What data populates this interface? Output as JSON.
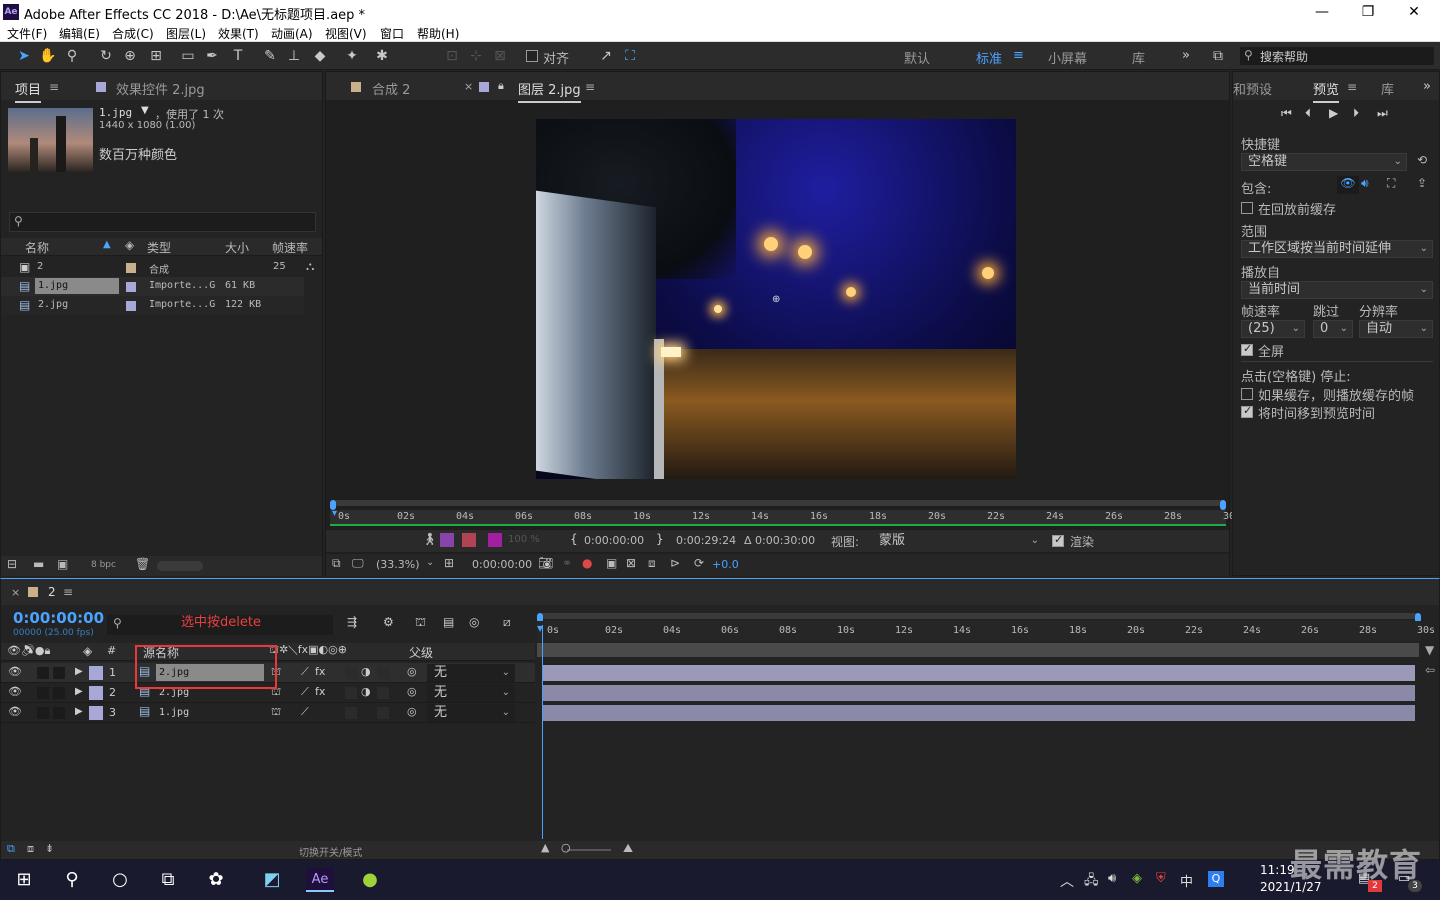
{
  "window": {
    "title": "Adobe After Effects CC 2018 - D:\\Ae\\无标题项目.aep *",
    "logo": "Ae"
  },
  "menu": [
    "文件(F)",
    "编辑(E)",
    "合成(C)",
    "图层(L)",
    "效果(T)",
    "动画(A)",
    "视图(V)",
    "窗口",
    "帮助(H)"
  ],
  "toolbar": {
    "snap_label": "对齐",
    "workspaces": [
      "默认",
      "标准",
      "小屏幕",
      "库"
    ],
    "active_workspace": "标准",
    "search_placeholder": "搜索帮助"
  },
  "project_panel": {
    "tabs": [
      "项目",
      "效果控件 2.jpg"
    ],
    "selected_name": "1.jpg",
    "usage": "，使用了 1 次",
    "dimensions": "1440 x 1080 (1.00)",
    "color_info": "数百万种颜色",
    "columns": [
      "名称",
      "类型",
      "大小",
      "帧速率"
    ],
    "items": [
      {
        "name": "2",
        "type": "合成",
        "size": "",
        "fps": "25",
        "color": "#c8b08a"
      },
      {
        "name": "1.jpg",
        "type": "Importe...G",
        "size": "61 KB",
        "fps": "",
        "color": "#a8a8d8"
      },
      {
        "name": "2.jpg",
        "type": "Importe...G",
        "size": "122 KB",
        "fps": "",
        "color": "#a8a8d8"
      }
    ],
    "bpc": "8 bpc"
  },
  "viewer": {
    "tabs": [
      "合成 2",
      "图层 2.jpg"
    ],
    "ruler_ticks": [
      "0s",
      "02s",
      "04s",
      "06s",
      "08s",
      "10s",
      "12s",
      "14s",
      "16s",
      "18s",
      "20s",
      "22s",
      "24s",
      "26s",
      "28s",
      "30s"
    ],
    "pct": "100 %",
    "in_time": "0:00:00:00",
    "out_time": "0:00:29:24",
    "duration": "Δ 0:00:30:00",
    "view_label": "视图:",
    "view_value": "蒙版",
    "render_label": "渲染",
    "zoom": "(33.3%)",
    "current_time": "0:00:00:00",
    "exposure": "+0.0"
  },
  "preview_panel": {
    "tabs": [
      "和预设",
      "预览",
      "库"
    ],
    "shortcut_label": "快捷键",
    "shortcut_value": "空格键",
    "include_label": "包含:",
    "cache_before": "在回放前缓存",
    "range_label": "范围",
    "range_value": "工作区域按当前时间延伸",
    "play_from_label": "播放自",
    "play_from_value": "当前时间",
    "fps_label": "帧速率",
    "skip_label": "跳过",
    "res_label": "分辨率",
    "fps_value": "(25)",
    "skip_value": "0",
    "res_value": "自动",
    "fullscreen": "全屏",
    "stop_label": "点击(空格键) 停止:",
    "if_cached": "如果缓存，则播放缓存的帧",
    "move_time": "将时间移到预览时间"
  },
  "timeline": {
    "comp_tab": "2",
    "timecode": "0:00:00:00",
    "fps_info": "00000 (25.00 fps)",
    "annotation": "选中按delete",
    "col_source": "源名称",
    "col_parent": "父级",
    "ruler_ticks": [
      "0s",
      "02s",
      "04s",
      "06s",
      "08s",
      "10s",
      "12s",
      "14s",
      "16s",
      "18s",
      "20s",
      "22s",
      "24s",
      "26s",
      "28s",
      "30s"
    ],
    "layers": [
      {
        "num": "1",
        "name": "2.jpg",
        "parent": "无",
        "selected": true
      },
      {
        "num": "2",
        "name": "2.jpg",
        "parent": "无",
        "selected": false
      },
      {
        "num": "3",
        "name": "1.jpg",
        "parent": "无",
        "selected": false
      }
    ],
    "toggle_label": "切换开关/模式"
  },
  "taskbar": {
    "time": "11:19",
    "date": "2021/1/27",
    "ime": "中",
    "badges": [
      "2",
      "3"
    ],
    "watermark": "最需教育"
  }
}
